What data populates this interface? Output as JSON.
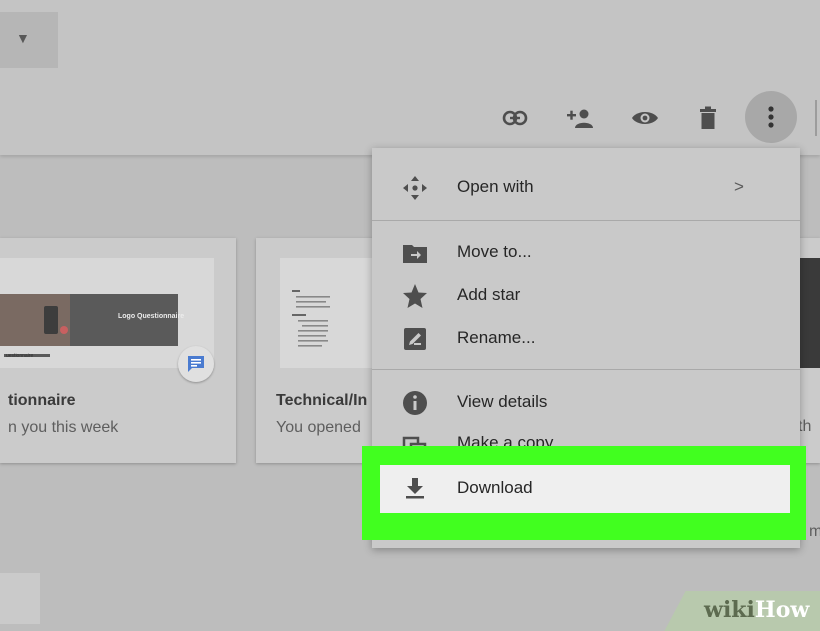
{
  "toolbar": {
    "icons": [
      "link-icon",
      "add-person-icon",
      "eye-icon",
      "trash-icon",
      "more-vert-icon"
    ]
  },
  "cards": [
    {
      "title": "tionnaire",
      "subtitle": "n you this week",
      "thumb_banner": "Logo Questionnaire",
      "thumb_caption": "uestionnaire"
    },
    {
      "title": "Technical/In",
      "subtitle": "You opened"
    }
  ],
  "edge_text": {
    "th": "th",
    "m": "m"
  },
  "menu": {
    "items": [
      {
        "label": "Open with",
        "icon": "move-arrows-icon",
        "arrow": ">"
      },
      {
        "label": "Move to...",
        "icon": "folder-move-icon"
      },
      {
        "label": "Add star",
        "icon": "star-icon"
      },
      {
        "label": "Rename...",
        "icon": "rename-icon"
      },
      {
        "label": "View details",
        "icon": "info-icon"
      },
      {
        "label": "Make a copy",
        "icon": "copy-icon"
      },
      {
        "label": "Download",
        "icon": "download-icon"
      }
    ]
  },
  "colors": {
    "highlight": "#41ff1f",
    "background": "#bdbdbd",
    "menu": "#c9c9c9"
  },
  "watermark": {
    "part1": "wiki",
    "part2": "How"
  }
}
